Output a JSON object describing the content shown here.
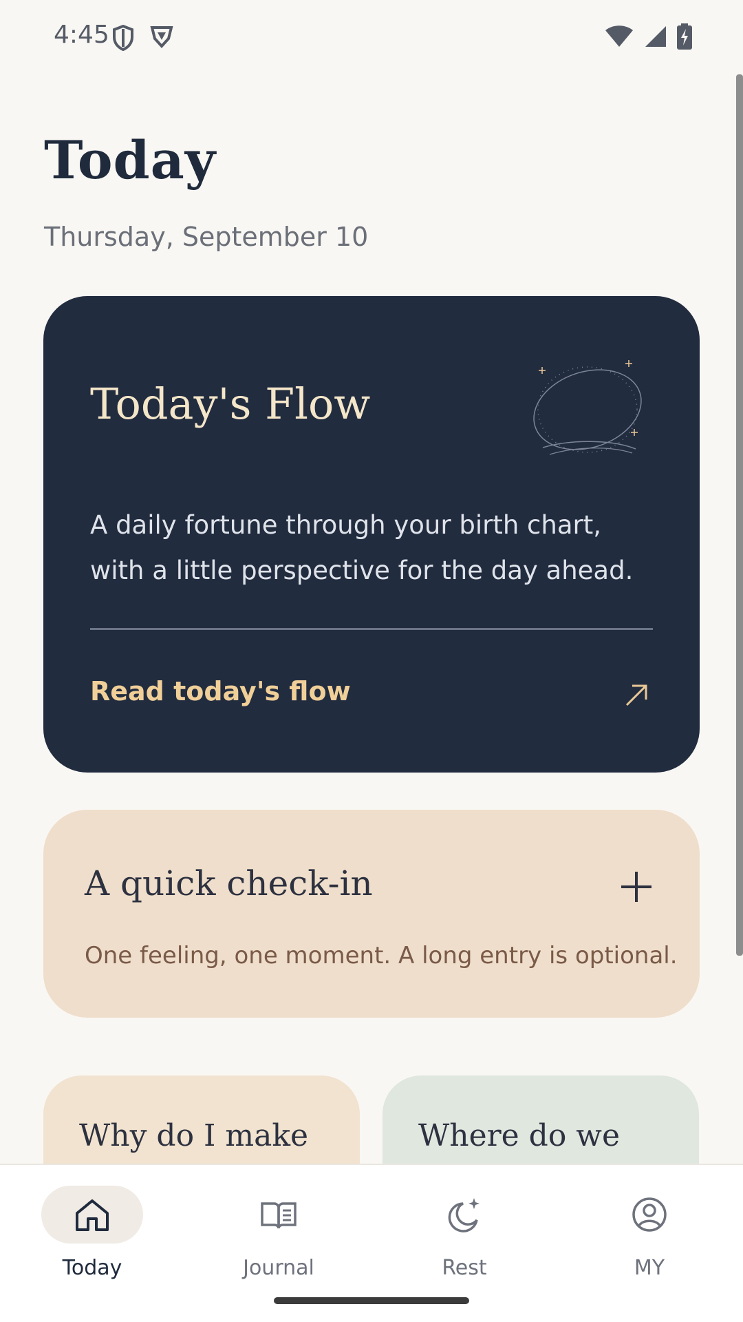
{
  "status_bar": {
    "time": "4:45"
  },
  "header": {
    "title": "Today",
    "date": "Thursday, September 10"
  },
  "flow_card": {
    "title": "Today's Flow",
    "description": "A daily fortune through your birth chart, with a little perspective for the day ahead.",
    "link_label": "Read today's flow"
  },
  "checkin_card": {
    "title": "A quick check-in",
    "subtitle": "One feeling, one moment. A long entry is optional."
  },
  "mini_cards": [
    {
      "title": "Why do I make"
    },
    {
      "title": "Where do we"
    }
  ],
  "nav": {
    "items": [
      {
        "label": "Today",
        "icon": "home-icon",
        "active": true
      },
      {
        "label": "Journal",
        "icon": "book-icon",
        "active": false
      },
      {
        "label": "Rest",
        "icon": "moon-sparkle-icon",
        "active": false
      },
      {
        "label": "MY",
        "icon": "profile-icon",
        "active": false
      }
    ]
  },
  "colors": {
    "background": "#f9f7f3",
    "flow_card": "#222c3f",
    "accent_gold": "#f0cf98",
    "checkin_card": "#efdecb"
  }
}
